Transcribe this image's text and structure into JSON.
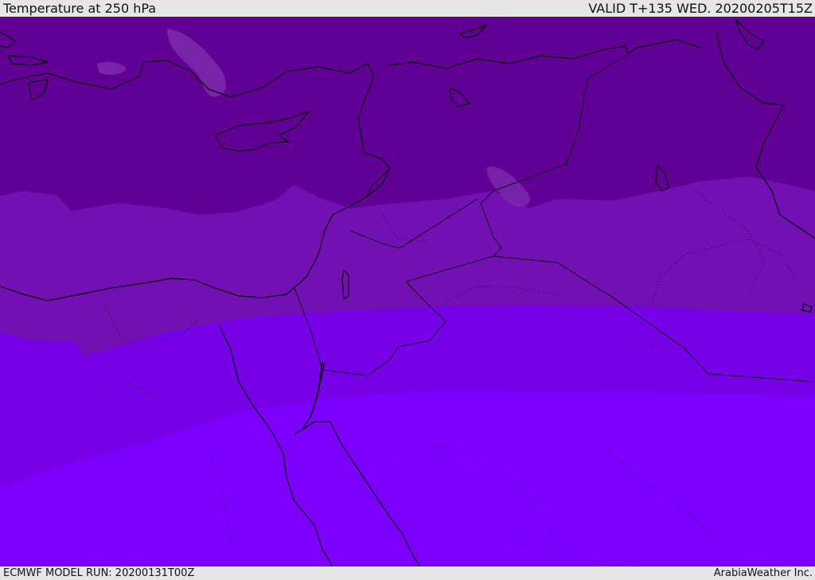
{
  "header": {
    "title": "Temperature at 250 hPa",
    "valid": "VALID T+135 WED. 20200205T15Z"
  },
  "footer": {
    "model_run": "ECMWF MODEL RUN: 20200131T00Z",
    "credit": "ArabiaWeather Inc."
  },
  "map": {
    "field": "temperature",
    "level": "250 hPa",
    "band_colors": [
      "#620096",
      "#7210b4",
      "#7600e6",
      "#7d00ff"
    ],
    "highlight_color": "#7c2aac",
    "coastline_color": "#000000"
  }
}
